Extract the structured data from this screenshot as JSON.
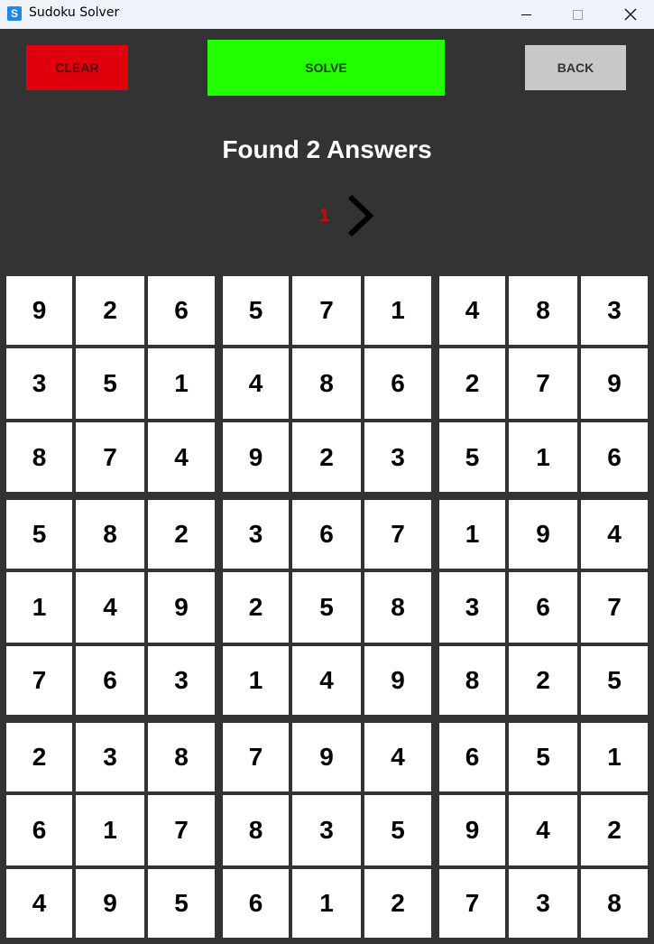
{
  "window": {
    "title": "Sudoku Solver",
    "icon_letter": "S",
    "icon": "app-icon",
    "controls": [
      "minimize-icon",
      "maximize-icon",
      "close-icon"
    ]
  },
  "toolbar": {
    "clear_label": "CLEAR",
    "solve_label": "SOLVE",
    "back_label": "BACK"
  },
  "colors": {
    "background": "#333333",
    "clear": "#e0000b",
    "solve": "#22ff00",
    "back": "#c8c8c8",
    "page_number": "#e00000"
  },
  "status": {
    "message": "Found 2 Answers"
  },
  "pagination": {
    "current": "1",
    "next_icon": "chevron-right-icon"
  },
  "board": [
    [
      "9",
      "2",
      "6",
      "5",
      "7",
      "1",
      "4",
      "8",
      "3"
    ],
    [
      "3",
      "5",
      "1",
      "4",
      "8",
      "6",
      "2",
      "7",
      "9"
    ],
    [
      "8",
      "7",
      "4",
      "9",
      "2",
      "3",
      "5",
      "1",
      "6"
    ],
    [
      "5",
      "8",
      "2",
      "3",
      "6",
      "7",
      "1",
      "9",
      "4"
    ],
    [
      "1",
      "4",
      "9",
      "2",
      "5",
      "8",
      "3",
      "6",
      "7"
    ],
    [
      "7",
      "6",
      "3",
      "1",
      "4",
      "9",
      "8",
      "2",
      "5"
    ],
    [
      "2",
      "3",
      "8",
      "7",
      "9",
      "4",
      "6",
      "5",
      "1"
    ],
    [
      "6",
      "1",
      "7",
      "8",
      "3",
      "5",
      "9",
      "4",
      "2"
    ],
    [
      "4",
      "9",
      "5",
      "6",
      "1",
      "2",
      "7",
      "3",
      "8"
    ]
  ]
}
